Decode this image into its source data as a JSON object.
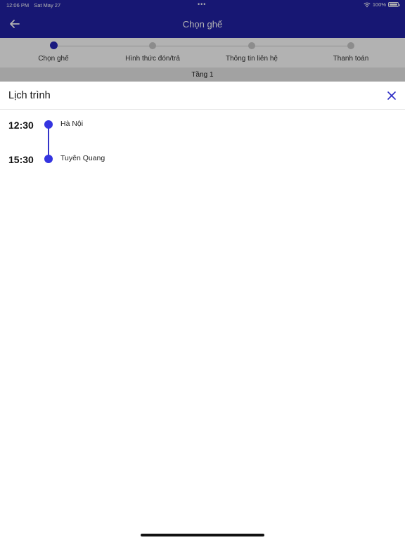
{
  "status_bar": {
    "time": "12:06 PM",
    "date": "Sat May 27",
    "battery": "100%"
  },
  "header": {
    "title": "Chọn ghế",
    "back_icon": "arrow-left-icon"
  },
  "stepper": {
    "steps": [
      {
        "label": "Chọn ghế",
        "active": true
      },
      {
        "label": "Hình thức đón/trả",
        "active": false
      },
      {
        "label": "Thông tin liên hệ",
        "active": false
      },
      {
        "label": "Thanh toán",
        "active": false
      }
    ]
  },
  "floor": {
    "label": "Tầng 1"
  },
  "sheet": {
    "title": "Lịch trình",
    "close_icon": "close-icon",
    "stops": [
      {
        "time": "12:30",
        "place": "Hà Nội"
      },
      {
        "time": "15:30",
        "place": "Tuyên Quang"
      }
    ]
  },
  "colors": {
    "header_bg": "#2222a5",
    "accent": "#3434e0"
  }
}
